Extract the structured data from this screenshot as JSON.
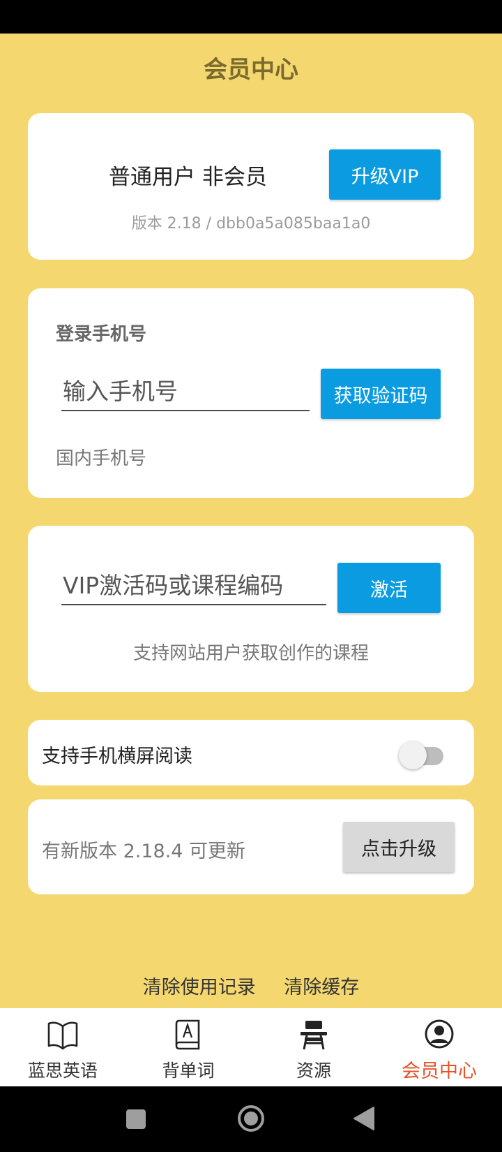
{
  "header": {
    "title": "会员中心"
  },
  "account": {
    "status": "普通用户 非会员",
    "upgrade_label": "升级VIP",
    "version": "版本 2.18  / dbb0a5a085baa1a0"
  },
  "login": {
    "label": "登录手机号",
    "phone_placeholder": "输入手机号",
    "get_code_label": "获取验证码",
    "hint": "国内手机号"
  },
  "activation": {
    "placeholder": "VIP激活码或课程编码",
    "activate_label": "激活",
    "hint": "支持网站用户获取创作的课程"
  },
  "settings": {
    "landscape_label": "支持手机横屏阅读",
    "landscape_enabled": false
  },
  "update": {
    "label": "有新版本 2.18.4 可更新",
    "button_label": "点击升级"
  },
  "links": {
    "clear_history": "清除使用记录",
    "clear_cache": "清除缓存"
  },
  "nav": {
    "items": [
      {
        "label": "蓝思英语",
        "icon": "book-icon"
      },
      {
        "label": "背单词",
        "icon": "vocabulary-book-icon"
      },
      {
        "label": "资源",
        "icon": "desk-icon"
      },
      {
        "label": "会员中心",
        "icon": "user-circle-icon",
        "active": true
      }
    ]
  },
  "colors": {
    "background": "#f4d86f",
    "accent_blue": "#0a9be0",
    "title": "#7b6a2e",
    "active_nav": "#e5532a"
  }
}
